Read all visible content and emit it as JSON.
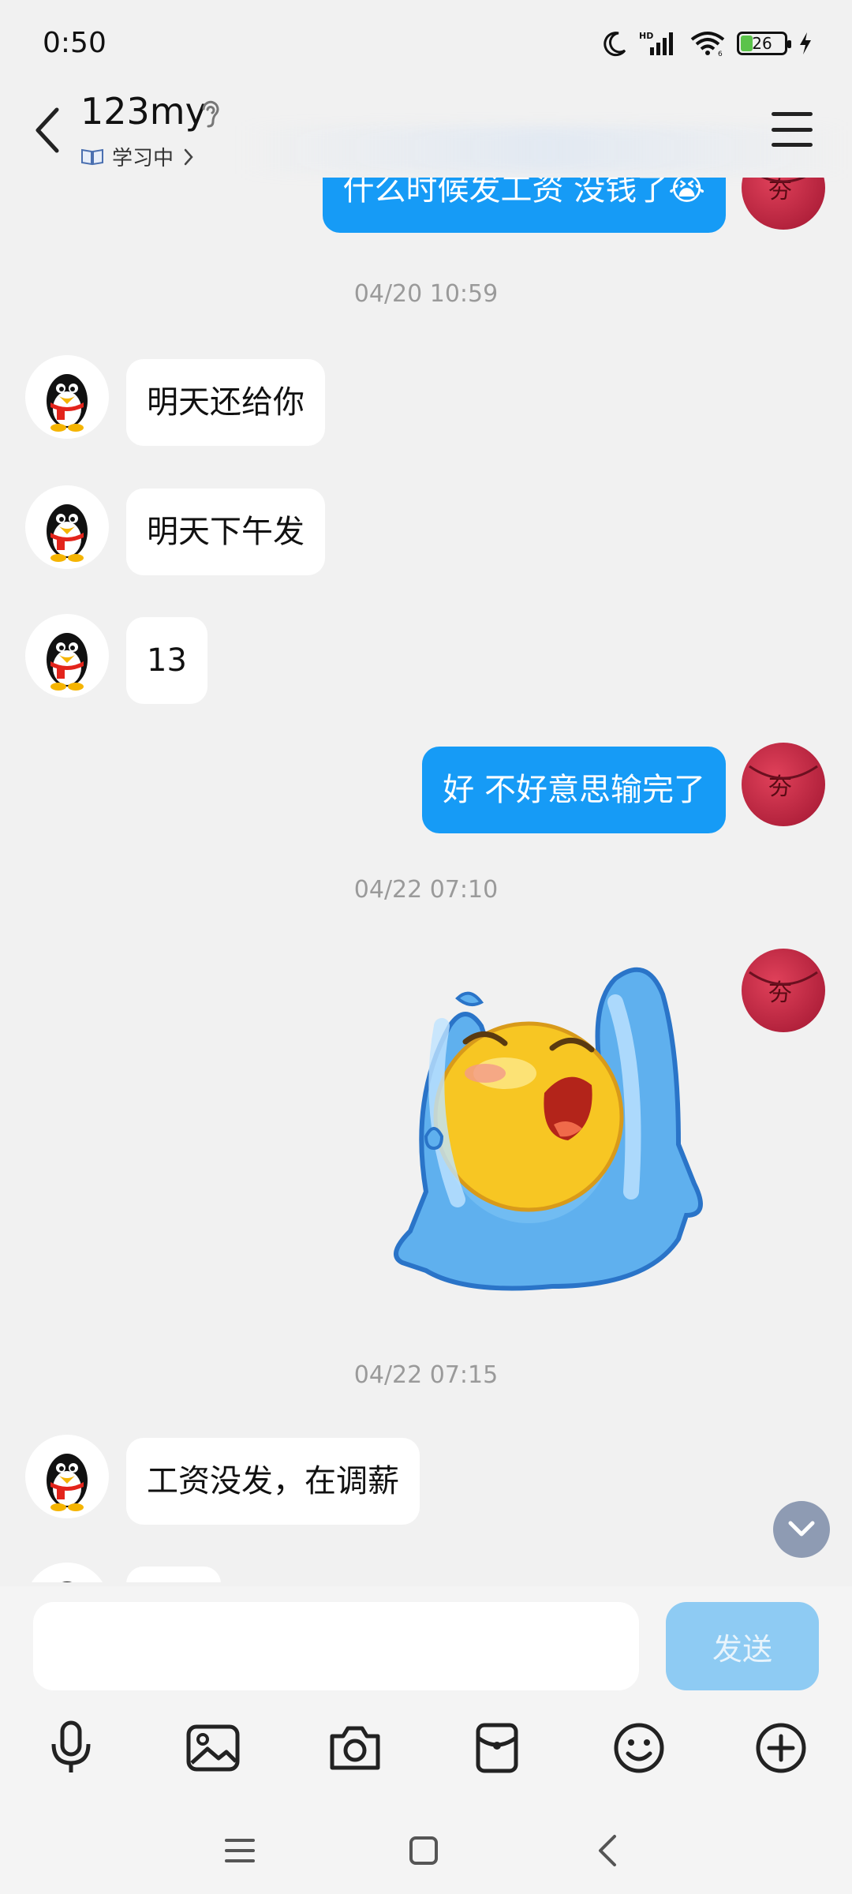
{
  "status_bar": {
    "time": "0:50",
    "battery": "26",
    "network_label": "HD"
  },
  "header": {
    "contact_name": "123my",
    "status_text": "学习中",
    "status_icon": "book-icon"
  },
  "messages": [
    {
      "dir": "out",
      "text": "什么时候发工资  没钱了😭"
    },
    {
      "type": "time",
      "text": "04/20 10:59"
    },
    {
      "dir": "in",
      "text": "明天还给你"
    },
    {
      "dir": "in",
      "text": "明天下午发"
    },
    {
      "dir": "in",
      "text": "13"
    },
    {
      "dir": "out",
      "text": "好 不好意思输完了"
    },
    {
      "type": "time",
      "text": "04/22 07:10"
    },
    {
      "dir": "out",
      "type": "sticker",
      "sticker": "crying-face-sticker"
    },
    {
      "type": "time",
      "text": "04/22 07:15"
    },
    {
      "dir": "in",
      "text": "工资没发，在调薪"
    }
  ],
  "input": {
    "placeholder": "",
    "value": ""
  },
  "send_label": "发送",
  "toolbar": [
    "microphone-icon",
    "image-icon",
    "camera-icon",
    "red-packet-icon",
    "emoji-icon",
    "plus-icon"
  ],
  "colors": {
    "outgoing_bubble": "#169bf6",
    "incoming_bubble": "#ffffff",
    "send_button": "#8ecbf3",
    "background": "#f1f1f1"
  }
}
